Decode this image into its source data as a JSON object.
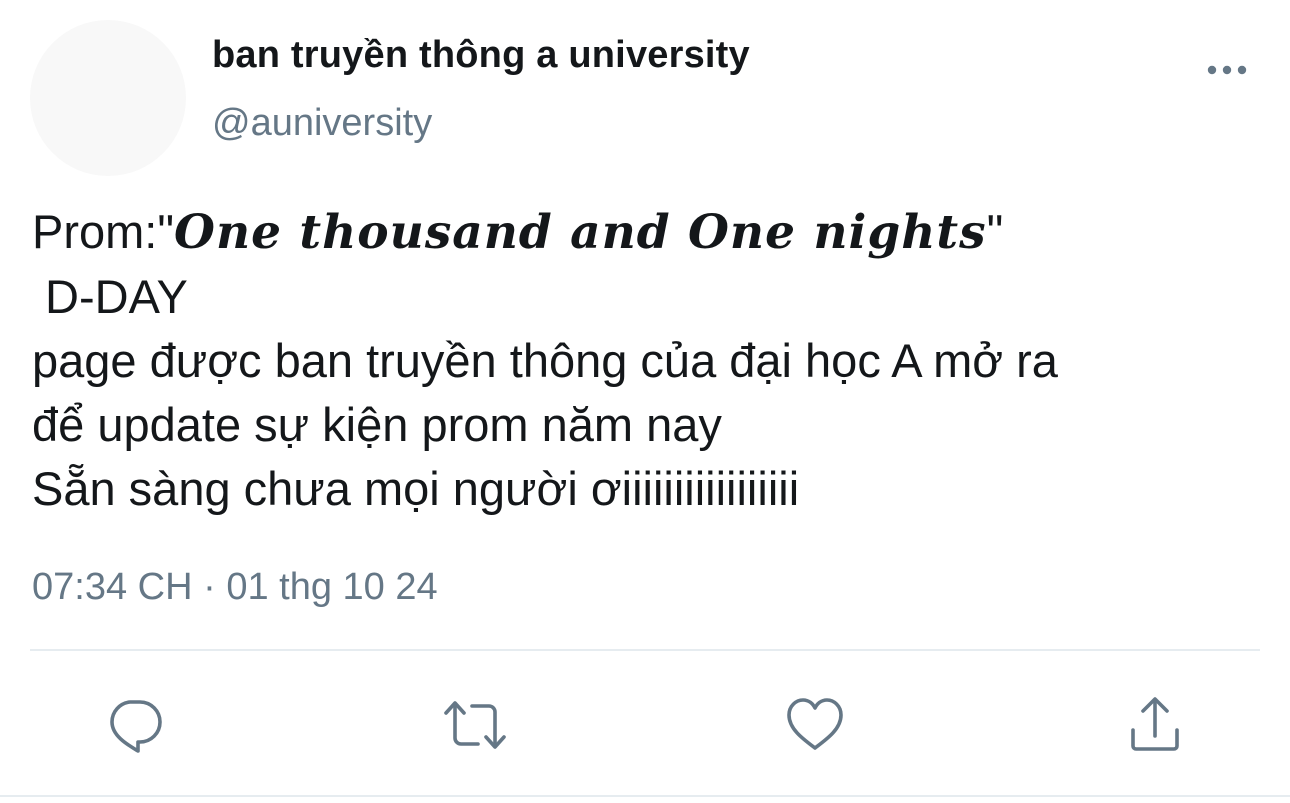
{
  "author": {
    "display_name": "ban truyền thông a university",
    "handle": "@auniversity"
  },
  "tweet": {
    "prefix": "Prom:\"",
    "fancy_title": "One thousand and One nights",
    "suffix": "\"",
    "line2": " D-DAY",
    "line3": "page được ban truyền thông của đại học A mở ra",
    "line4": "để update sự kiện prom năm nay",
    "line5": "Sẵn sàng chưa mọi người ơiiiiiiiiiiiiiiiii"
  },
  "meta": {
    "time": "07:34 CH",
    "separator": " · ",
    "date": "01 thg 10 24"
  },
  "actions": {
    "reply_icon": "reply-icon",
    "retweet_icon": "retweet-icon",
    "like_icon": "heart-icon",
    "share_icon": "share-icon"
  },
  "colors": {
    "text": "#14171a",
    "secondary": "#657786",
    "icon": "#657786",
    "divider": "#e6ecf0"
  }
}
